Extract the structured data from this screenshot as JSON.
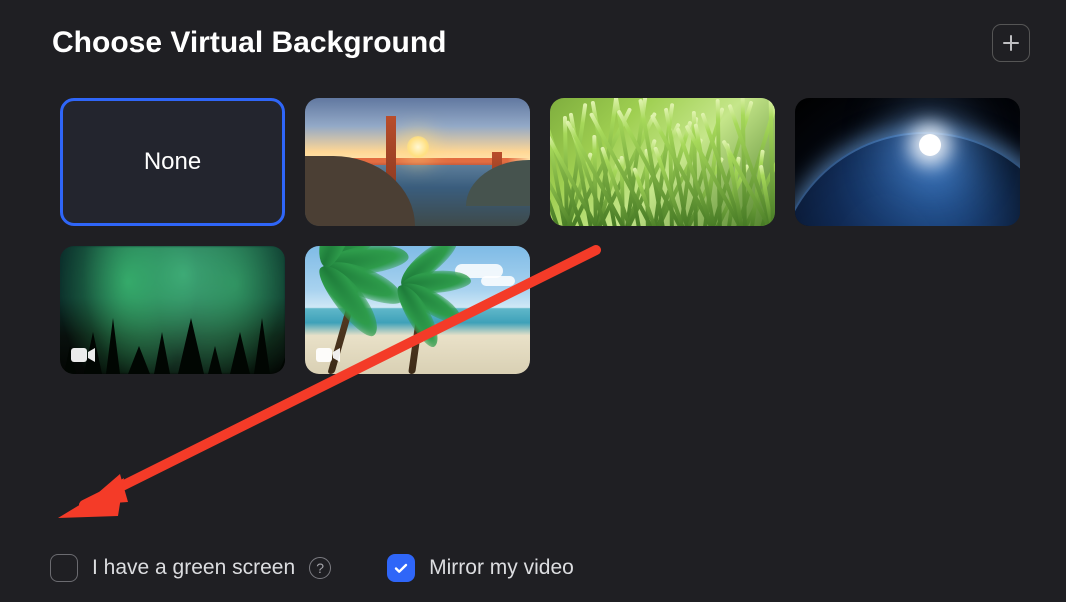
{
  "title": "Choose Virtual Background",
  "backgrounds": [
    {
      "kind": "none",
      "label": "None",
      "selected": true,
      "video": false,
      "name": "bg-option-none"
    },
    {
      "kind": "bridge",
      "label": "",
      "selected": false,
      "video": false,
      "name": "bg-option-golden-gate"
    },
    {
      "kind": "grass",
      "label": "",
      "selected": false,
      "video": false,
      "name": "bg-option-grass"
    },
    {
      "kind": "earth",
      "label": "",
      "selected": false,
      "video": false,
      "name": "bg-option-earth"
    },
    {
      "kind": "aurora",
      "label": "",
      "selected": false,
      "video": true,
      "name": "bg-option-aurora"
    },
    {
      "kind": "beach",
      "label": "",
      "selected": false,
      "video": true,
      "name": "bg-option-beach"
    }
  ],
  "options": {
    "green_screen": {
      "label": "I have a green screen",
      "checked": false
    },
    "mirror": {
      "label": "Mirror my video",
      "checked": true
    }
  },
  "icons": {
    "add": "plus-icon",
    "help": "?",
    "video": "video-camera-icon"
  },
  "annotation": {
    "type": "arrow",
    "color": "#f43b28",
    "from_thumb": "bg-option-grass",
    "to": "green-screen-checkbox"
  }
}
